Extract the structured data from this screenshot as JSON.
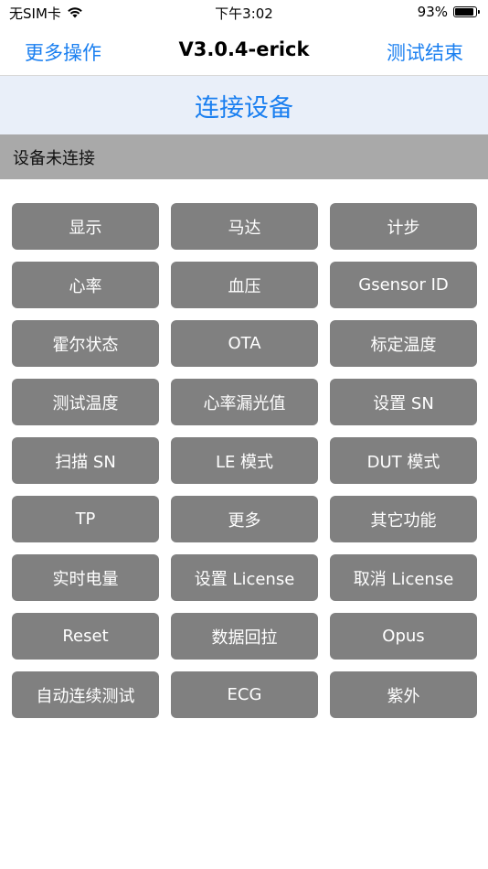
{
  "status_bar": {
    "carrier": "无SIM卡",
    "time": "下午3:02",
    "battery_percent_text": "93%",
    "battery_level": 0.93
  },
  "nav": {
    "left_label": "更多操作",
    "title": "V3.0.4-erick",
    "right_label": "测试结束"
  },
  "connect": {
    "label": "连接设备"
  },
  "device_status": {
    "label": "设备未连接"
  },
  "buttons": [
    "显示",
    "马达",
    "计步",
    "心率",
    "血压",
    "Gsensor ID",
    "霍尔状态",
    "OTA",
    "标定温度",
    "测试温度",
    "心率漏光值",
    "设置 SN",
    "扫描 SN",
    "LE 模式",
    "DUT 模式",
    "TP",
    "更多",
    "其它功能",
    "实时电量",
    "设置 License",
    "取消 License",
    "Reset",
    "数据回拉",
    "Opus",
    "自动连续测试",
    "ECG",
    "紫外"
  ],
  "colors": {
    "accent": "#1a7ff0",
    "button_bg": "#808080",
    "connect_bg": "#e9eff9",
    "status_strip_bg": "#a9a9a9"
  }
}
